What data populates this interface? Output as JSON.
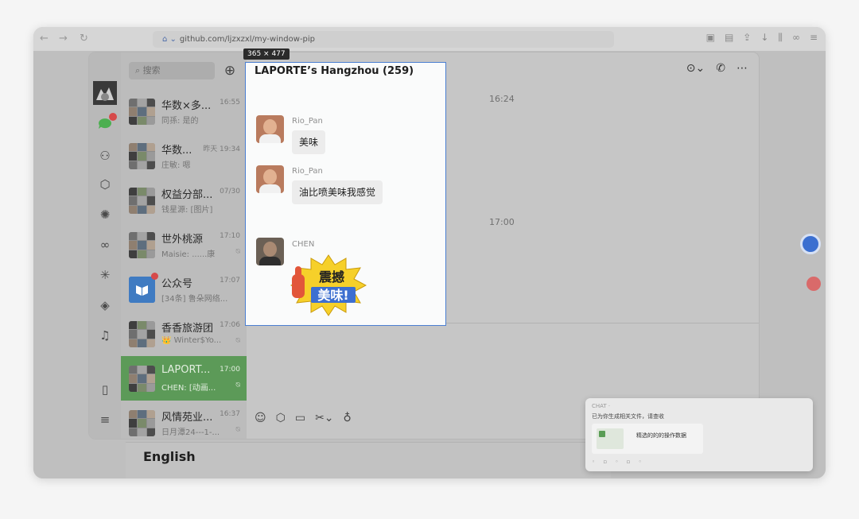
{
  "browser": {
    "url": "github.com/ljzxzxl/my-window-pip",
    "back_icon": "arrow-left-icon",
    "forward_icon": "arrow-right-icon",
    "reload_icon": "reload-icon"
  },
  "size_tag": "365 × 477",
  "search": {
    "placeholder": "搜索"
  },
  "conversations": [
    {
      "name": "华数×多...",
      "time": "16:55",
      "preview": "同孫: 是的",
      "muted": false,
      "unread_dot": false,
      "active": false
    },
    {
      "name": "华数...",
      "time": "昨天 19:34",
      "preview": "庄敏: 嗯",
      "muted": false,
      "unread_dot": false,
      "active": false
    },
    {
      "name": "权益分部...",
      "time": "07/30",
      "preview": "钱星源: [图片]",
      "muted": false,
      "unread_dot": false,
      "active": false
    },
    {
      "name": "世外桃源",
      "time": "17:10",
      "preview": "Maisie: ......康",
      "muted": true,
      "unread_dot": false,
      "active": false
    },
    {
      "name": "公众号",
      "time": "17:07",
      "preview": "[34条] 鲁朵网络...",
      "muted": false,
      "unread_dot": true,
      "active": false
    },
    {
      "name": "香香旅游团",
      "time": "17:06",
      "preview": "👑 Winter$Yo...",
      "muted": true,
      "unread_dot": false,
      "active": false
    },
    {
      "name": "LAPORT...",
      "time": "17:00",
      "preview": "CHEN: [动画...",
      "muted": true,
      "unread_dot": false,
      "active": true
    },
    {
      "name": "风情苑业...",
      "time": "16:37",
      "preview": "日月潭24---1-...",
      "muted": true,
      "unread_dot": false,
      "active": false
    }
  ],
  "mute_glyph": "⍉",
  "chat": {
    "timestamps": [
      "16:24",
      "17:00"
    ]
  },
  "pip": {
    "title": "LAPORTE’s Hangzhou (259)",
    "messages": [
      {
        "sender": "Rio_Pan",
        "text": "美味"
      },
      {
        "sender": "Rio_Pan",
        "text": "油比喷美味我感觉"
      },
      {
        "sender": "CHEN",
        "sticker": true
      }
    ],
    "sticker_text": [
      "震撼",
      "美味!"
    ]
  },
  "page": {
    "english_heading": "English"
  },
  "notification": {
    "header": "CHAT ·",
    "text": "已为你生成相关文件，请查收",
    "file_name": "精选的的的操作数据",
    "icons": "◦ ▫ ◦ ▫ ◦"
  },
  "colors": {
    "accent_green": "#5c9a58",
    "pip_border": "#4b7fd1",
    "badge_red": "#d64a4a"
  }
}
